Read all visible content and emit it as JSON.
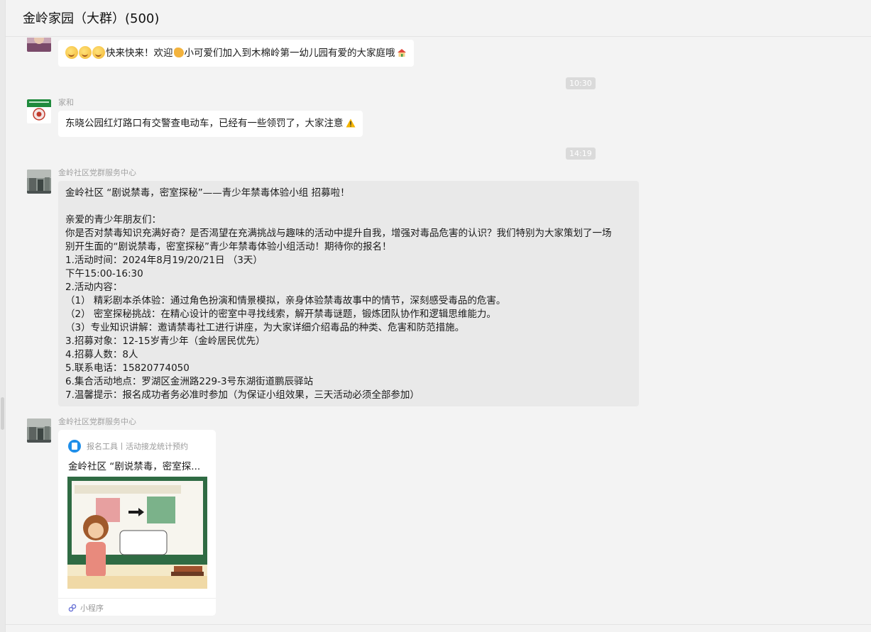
{
  "window": {
    "title": "金岭家园（大群）(500)"
  },
  "messages": [
    {
      "text": "快来快来！欢迎",
      "text2": "小可爱们加入到木棉岭第一幼儿园有爱的大家庭哦"
    },
    {
      "sender": "家和",
      "text": "东晓公园红灯路口有交警查电动车，已经有一些领罚了，大家注意"
    },
    {
      "sender": "金岭社区党群服务中心",
      "lines": [
        "金岭社区 “剧说禁毒，密室探秘”——青少年禁毒体验小组 招募啦！",
        "",
        "亲爱的青少年朋友们：",
        "你是否对禁毒知识充满好奇？是否渴望在充满挑战与趣味的活动中提升自我，增强对毒品危害的认识？我们特别为大家策划了一场",
        "别开生面的“剧说禁毒，密室探秘”青少年禁毒体验小组活动！期待你的报名！",
        "1.活动时间：2024年8月19/20/21日 （3天）",
        "下午15:00-16:30",
        "2.活动内容：",
        "（1） 精彩剧本杀体验：通过角色扮演和情景模拟，亲身体验禁毒故事中的情节，深刻感受毒品的危害。",
        "（2） 密室探秘挑战：在精心设计的密室中寻找线索，解开禁毒谜题，锻炼团队协作和逻辑思维能力。",
        "（3）专业知识讲解：邀请禁毒社工进行讲座，为大家详细介绍毒品的种类、危害和防范措施。",
        "3.招募对象：12-15岁青少年（金岭居民优先）",
        "4.招募人数：8人",
        "5.联系电话：15820774050",
        "6.集合活动地点：罗湖区金洲路229-3号东湖街道鹏辰驿站",
        "7.温馨提示：报名成功者务必准时参加（为保证小组效果，三天活动必须全部参加）"
      ]
    },
    {
      "sender": "金岭社区党群服务中心",
      "card": {
        "source": "报名工具丨活动接龙统计预约",
        "title": "金岭社区 “剧说禁毒，密室探...",
        "footer": "小程序"
      }
    }
  ],
  "timestamps": [
    "10:30",
    "14:19"
  ],
  "colors": {
    "background": "#f3f3f3",
    "bubble": "#ffffff",
    "bubble_gray": "#e9e9e9",
    "timestamp_bg": "#dadada",
    "sender": "#a3a3a3"
  },
  "icons": [
    "smile-emoji-icon",
    "clap-emoji-icon",
    "house-emoji-icon",
    "warning-emoji-icon",
    "miniprogram-icon",
    "form-tool-icon"
  ]
}
